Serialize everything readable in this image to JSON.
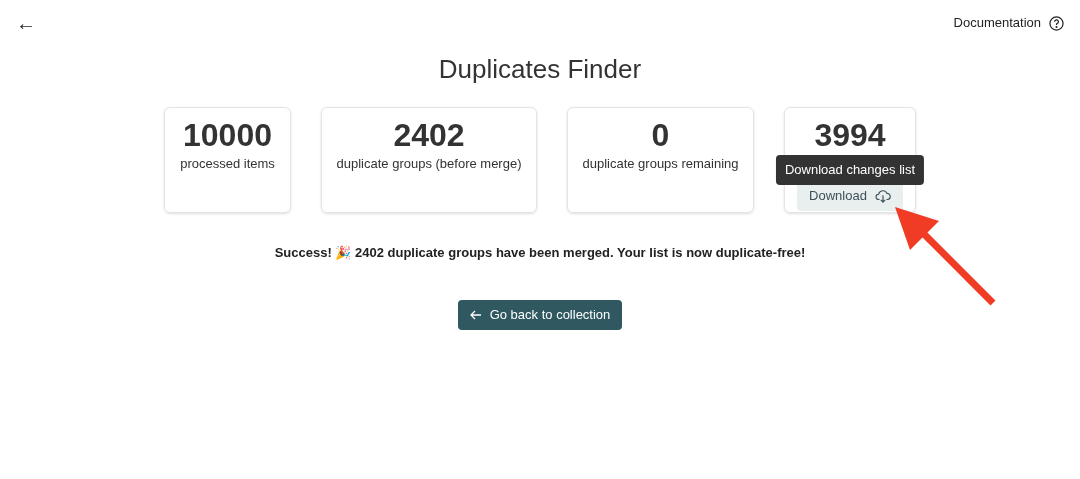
{
  "header": {
    "back_icon": "←",
    "documentation_link": "Documentation"
  },
  "title": "Duplicates Finder",
  "stats": [
    {
      "kind": "stat",
      "value": "10000",
      "label": "processed items"
    },
    {
      "kind": "stat",
      "value": "2402",
      "label": "duplicate groups (before merge)"
    },
    {
      "kind": "stat",
      "value": "0",
      "label": "duplicate groups remaining"
    },
    {
      "kind": "download",
      "value": "3994",
      "button": "Download",
      "tooltip": "Download changes list"
    }
  ],
  "message": "**Success! 🎉 2402 duplicate groups have been merged. Your list is now duplicate-free!**",
  "back_button": "Go back to collection"
}
